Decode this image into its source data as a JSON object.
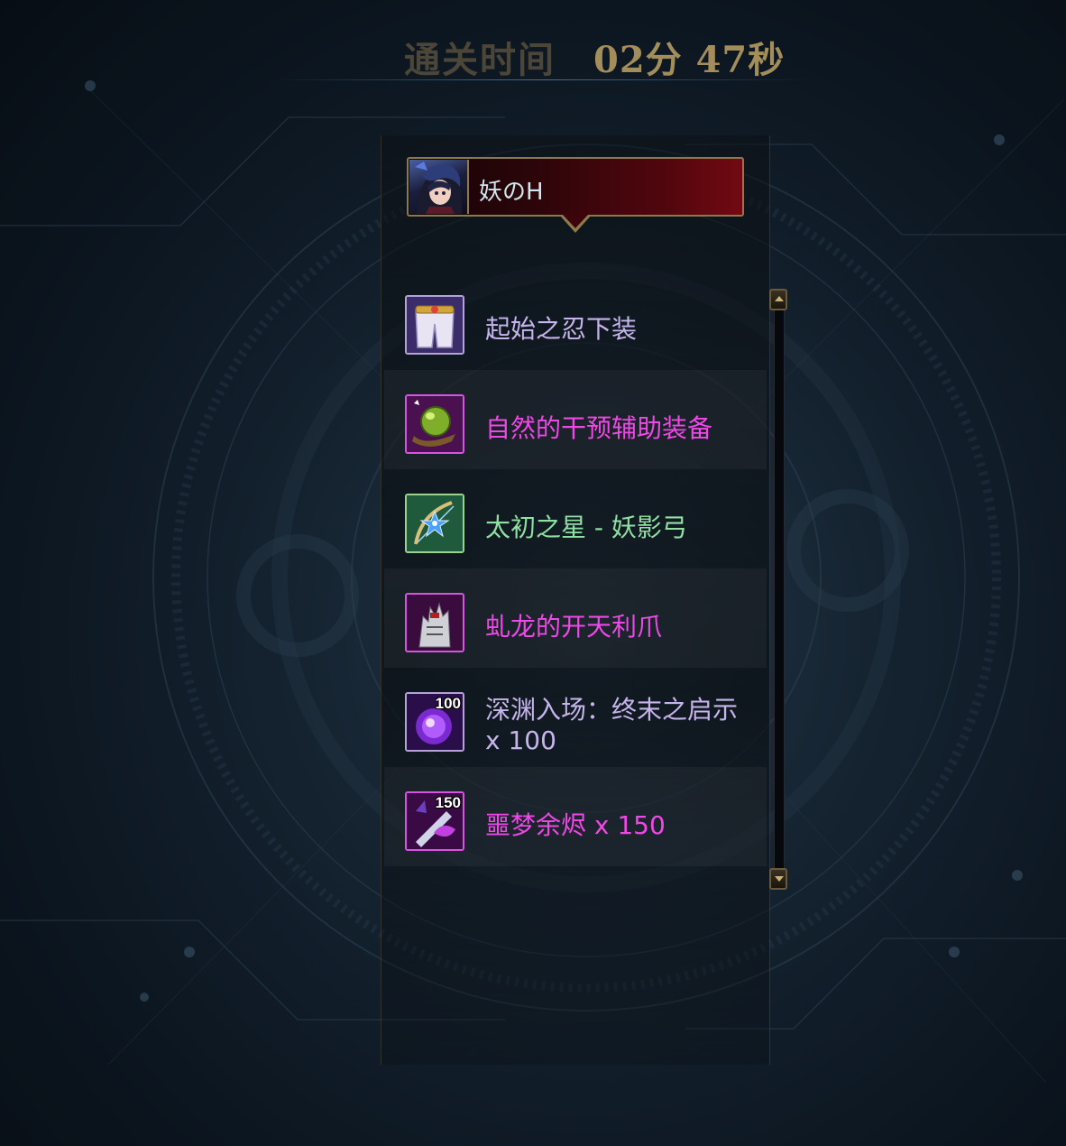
{
  "header": {
    "clear_time_label": "通关时间",
    "clear_time_value": "02分 47秒"
  },
  "player": {
    "name": "妖のH",
    "avatar_icon": "character-portrait-icon"
  },
  "rewards": [
    {
      "name": "起始之忍下装",
      "icon": "pants-armor-icon",
      "color": "#c6b5ec",
      "count": ""
    },
    {
      "name": "自然的干预辅助装备",
      "icon": "green-orb-accessory-icon",
      "color": "#ee48e6",
      "count": ""
    },
    {
      "name": "太初之星 - 妖影弓",
      "icon": "star-bow-weapon-icon",
      "color": "#8fe0a2",
      "count": ""
    },
    {
      "name": "虬龙的开天利爪",
      "icon": "dragon-claw-icon",
      "color": "#ee48e6",
      "count": ""
    },
    {
      "name": "深渊入场：终末之启示 x 100",
      "icon": "abyss-ticket-orb-icon",
      "color": "#c6b5ec",
      "count": "100"
    },
    {
      "name": "噩梦余烬 x 150",
      "icon": "nightmare-ember-icon",
      "color": "#ee48e6",
      "count": "150"
    }
  ],
  "scrollbar": {
    "up_icon": "scroll-up-arrow-icon",
    "down_icon": "scroll-down-arrow-icon"
  }
}
